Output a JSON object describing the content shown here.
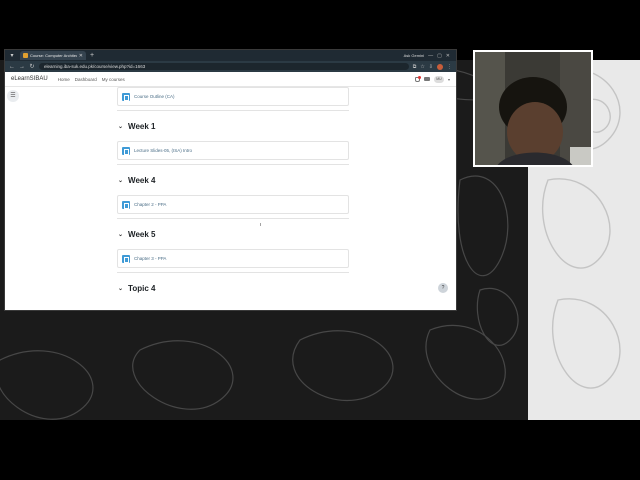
{
  "browser": {
    "tab_title": "Course: Computer Architecture",
    "ask_gemini": "Ask Gemini",
    "url": "elearning.iba-suk.edu.pk/course/view.php?id=1663"
  },
  "site": {
    "brand": "eLearnSIBAU",
    "nav": [
      "Home",
      "Dashboard",
      "My courses"
    ],
    "user_initials": "MU"
  },
  "course": {
    "items": [
      {
        "type": "activity",
        "label": "Course Outline (CA)"
      },
      {
        "type": "section",
        "label": "Week 1"
      },
      {
        "type": "activity",
        "label": "Lecture Slides-05, (ISA) Intro"
      },
      {
        "type": "section",
        "label": "Week 4"
      },
      {
        "type": "activity",
        "label": "Chapter 2 - PPA"
      },
      {
        "type": "section",
        "label": "Week 5"
      },
      {
        "type": "activity",
        "label": "Chapter 3 - PPA"
      },
      {
        "type": "section",
        "label": "Topic 4"
      }
    ]
  },
  "icons": {
    "activity": "pdf-file-icon",
    "section_toggle": "chevron-down-icon",
    "drawer": "course-index-icon",
    "help": "question-mark-icon"
  },
  "colors": {
    "accent": "#3e9ad6",
    "tabbar": "#1f2a33",
    "page_bg": "#1b1b1b"
  }
}
